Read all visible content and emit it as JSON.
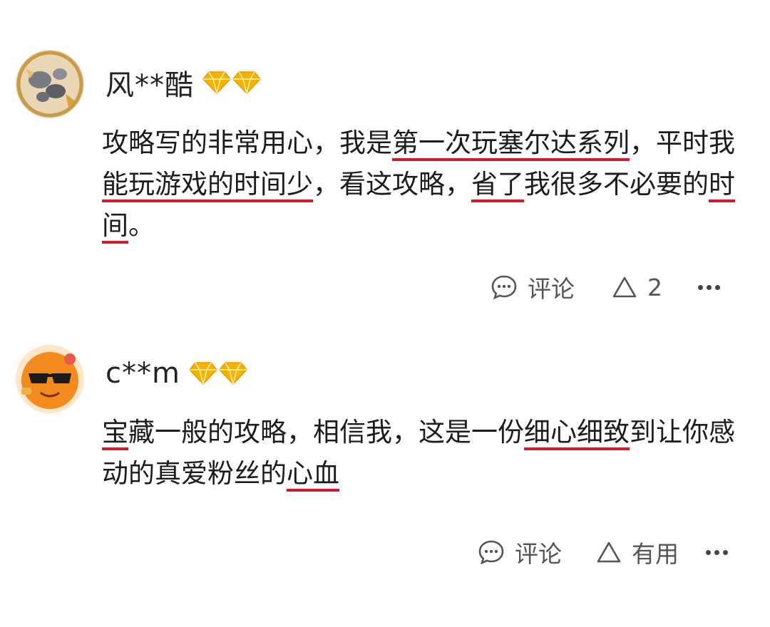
{
  "comments": [
    {
      "username": "风**酷",
      "segments": [
        {
          "text": "攻略写的非常用心，我是",
          "hl": false
        },
        {
          "text": "第一次玩塞尔达系列",
          "hl": true
        },
        {
          "text": "，平时我",
          "hl": false
        },
        {
          "text": "能玩游戏的时间少",
          "hl": true
        },
        {
          "text": "，看这攻略，",
          "hl": false
        },
        {
          "text": "省了",
          "hl": true
        },
        {
          "text": "我很多不必要的",
          "hl": false
        },
        {
          "text": "时间",
          "hl": true
        },
        {
          "text": "。",
          "hl": false
        }
      ],
      "actions": {
        "comment_label": "评论",
        "like_label": "2"
      },
      "avatar_icon": "stones-avatar-icon"
    },
    {
      "username": "c**m",
      "segments": [
        {
          "text": "宝",
          "hl": true
        },
        {
          "text": "藏一般的攻略，相信我，这是一份",
          "hl": false
        },
        {
          "text": "细心细致",
          "hl": true
        },
        {
          "text": "到让你感动的真爱粉丝的",
          "hl": false
        },
        {
          "text": "心血",
          "hl": true
        }
      ],
      "actions": {
        "comment_label": "评论",
        "like_label": "有用"
      },
      "avatar_icon": "sunglasses-avatar-icon"
    }
  ],
  "colors": {
    "highlight": "#d11a2a",
    "diamond": "#f5b301",
    "text": "#1c1c1c",
    "muted": "#555555"
  }
}
